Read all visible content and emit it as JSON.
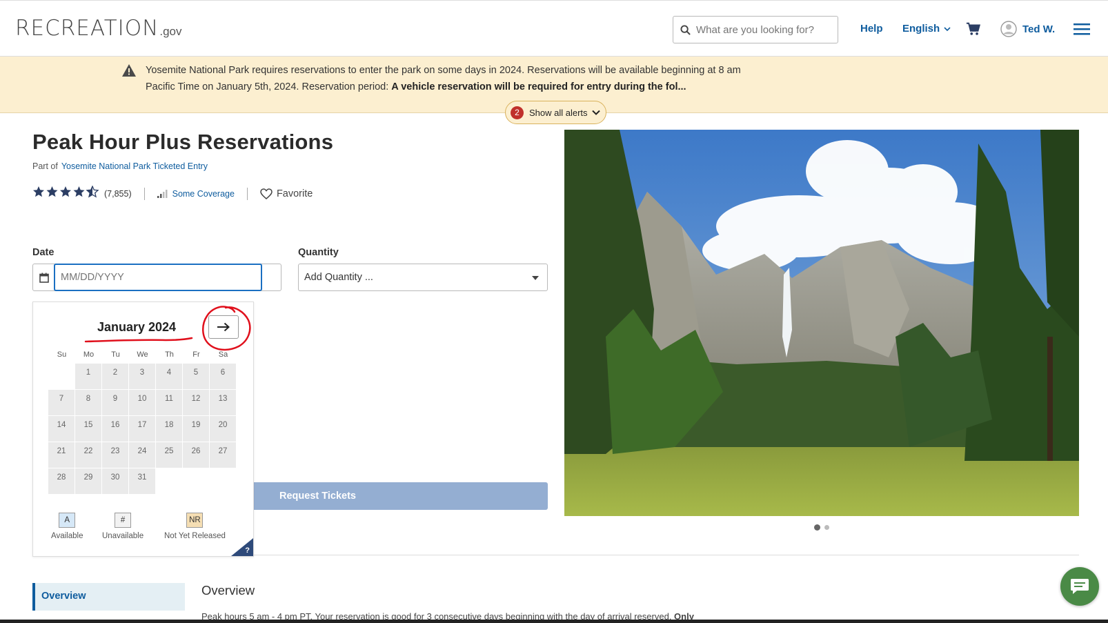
{
  "header": {
    "logo_text": "RECREATION",
    "logo_suffix": ".gov",
    "search_placeholder": "What are you looking for?",
    "help_label": "Help",
    "language_label": "English",
    "user_name": "Ted W."
  },
  "alert": {
    "text_line1": "Yosemite National Park requires reservations to enter the park on some days in 2024.  Reservations will be available beginning at 8 am",
    "text_line2_prefix": "Pacific Time on January 5th, 2024.  Reservation period: ",
    "text_line2_bold": "A vehicle reservation will be required for entry during the fol...",
    "count": "2",
    "show_all_label": "Show all alerts"
  },
  "main": {
    "title": "Peak Hour Plus Reservations",
    "part_of_prefix": "Part of",
    "part_of_link": "Yosemite National Park Ticketed Entry",
    "rating_stars": 4.5,
    "rating_count": "(7,855)",
    "coverage_label": "Some Coverage",
    "favorite_label": "Favorite",
    "date_label": "Date",
    "date_placeholder": "MM/DD/YYYY",
    "quantity_label": "Quantity",
    "quantity_placeholder": "Add Quantity ...",
    "request_button": "Request Tickets"
  },
  "calendar": {
    "month_label": "January 2024",
    "weekdays": [
      "Su",
      "Mo",
      "Tu",
      "We",
      "Th",
      "Fr",
      "Sa"
    ],
    "days": [
      "1",
      "2",
      "3",
      "4",
      "5",
      "6",
      "7",
      "8",
      "9",
      "10",
      "11",
      "12",
      "13",
      "14",
      "15",
      "16",
      "17",
      "18",
      "19",
      "20",
      "21",
      "22",
      "23",
      "24",
      "25",
      "26",
      "27",
      "28",
      "29",
      "30",
      "31"
    ],
    "first_weekday_index": 1,
    "legend": [
      {
        "symbol": "A",
        "label": "Available",
        "color": "#d6e8f7"
      },
      {
        "symbol": "#",
        "label": "Unavailable",
        "color": "#f2f2f2"
      },
      {
        "symbol": "NR",
        "label": "Not Yet Released",
        "color": "#f5deb3"
      }
    ],
    "help_symbol": "?"
  },
  "content": {
    "sidebar_item": "Overview",
    "overview_title": "Overview",
    "overview_text_prefix": "Peak hours 5 am - 4 pm PT. Your reservation is good for 3 consecutive days beginning with the day of arrival reserved. ",
    "overview_text_bold": "Only"
  },
  "colors": {
    "accent": "#0e5c9e",
    "alert_bg": "#fcefd0",
    "annotation": "#e0101c",
    "chat": "#4a8a46"
  }
}
